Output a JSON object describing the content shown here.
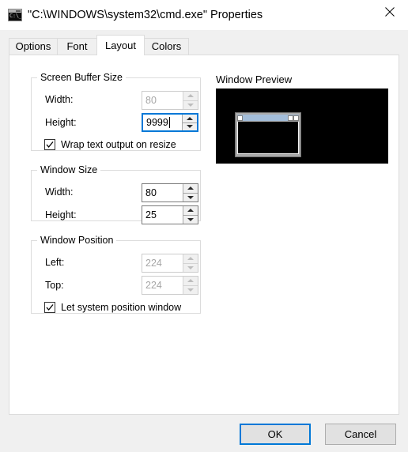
{
  "window": {
    "title": "\"C:\\WINDOWS\\system32\\cmd.exe\" Properties",
    "icon": "cmd-console-icon",
    "icon_text": "C:\\_",
    "close_icon": "close-icon"
  },
  "tabs": [
    {
      "label": "Options",
      "selected": false
    },
    {
      "label": "Font",
      "selected": false
    },
    {
      "label": "Layout",
      "selected": true
    },
    {
      "label": "Colors",
      "selected": false
    }
  ],
  "groups": {
    "screen_buffer_size": {
      "label": "Screen Buffer Size",
      "width": {
        "label": "Width:",
        "value": "80",
        "disabled": true,
        "focused": false
      },
      "height": {
        "label": "Height:",
        "value": "9999",
        "disabled": false,
        "focused": true
      },
      "wrap_text": {
        "label": "Wrap text output on resize",
        "checked": true
      }
    },
    "window_size": {
      "label": "Window Size",
      "width": {
        "label": "Width:",
        "value": "80",
        "disabled": false,
        "focused": false
      },
      "height": {
        "label": "Height:",
        "value": "25",
        "disabled": false,
        "focused": false
      }
    },
    "window_position": {
      "label": "Window Position",
      "left": {
        "label": "Left:",
        "value": "224",
        "disabled": true,
        "focused": false
      },
      "top": {
        "label": "Top:",
        "value": "224",
        "disabled": true,
        "focused": false
      },
      "let_system_position": {
        "label": "Let system position window",
        "checked": true
      }
    }
  },
  "preview": {
    "title": "Window Preview",
    "screen_color": "#000000",
    "window_titlebar_color": "#a3bdd9",
    "window_frame_color": "#a9a9a9"
  },
  "buttons": {
    "ok": "OK",
    "cancel": "Cancel"
  },
  "colors": {
    "accent": "#0078d7",
    "dialog_background": "#f0f0f0",
    "panel_background": "#ffffff",
    "disabled_text": "#a6a6a6"
  }
}
